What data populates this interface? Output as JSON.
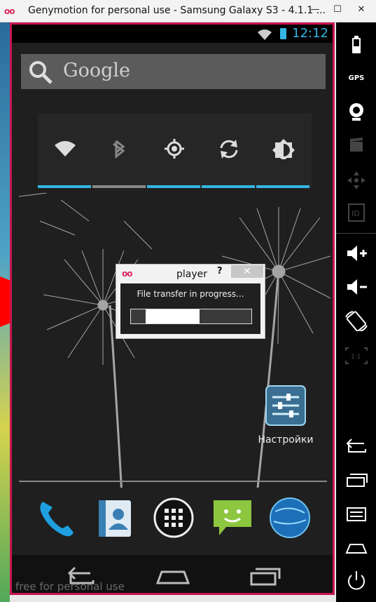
{
  "window": {
    "logo_text": "oo",
    "title": "Genymotion for personal use - Samsung Galaxy S3 - 4.1.1 ...",
    "controls": [
      "—",
      "☐",
      "✕"
    ]
  },
  "statusbar": {
    "time": "12:12",
    "wifi_icon": "wifi-icon",
    "battery_icon": "battery-charging-icon"
  },
  "search": {
    "text": "Google",
    "icon": "search-icon"
  },
  "quick_settings": [
    {
      "name": "wifi",
      "icon": "wifi-icon",
      "enabled": true
    },
    {
      "name": "bluetooth",
      "icon": "bluetooth-icon",
      "enabled": false
    },
    {
      "name": "gps",
      "icon": "gps-icon",
      "enabled": true
    },
    {
      "name": "sync",
      "icon": "sync-icon",
      "enabled": true
    },
    {
      "name": "brightness",
      "icon": "brightness-icon",
      "enabled": true
    }
  ],
  "colors": {
    "accent": "#34b5e5",
    "frame": "#c8164f",
    "logo": "#d9285e"
  },
  "home": {
    "settings_label": "Настройки",
    "watermark": "free for personal use"
  },
  "dock": [
    "phone-icon",
    "contacts-icon",
    "app-drawer-icon",
    "messaging-icon",
    "browser-icon"
  ],
  "dialog": {
    "logo": "oo",
    "title": "player",
    "help": "?",
    "close": "✕",
    "message": "File transfer in progress...",
    "progress_fraction": 0.45
  },
  "side_panel": {
    "gps_label": "GPS"
  }
}
